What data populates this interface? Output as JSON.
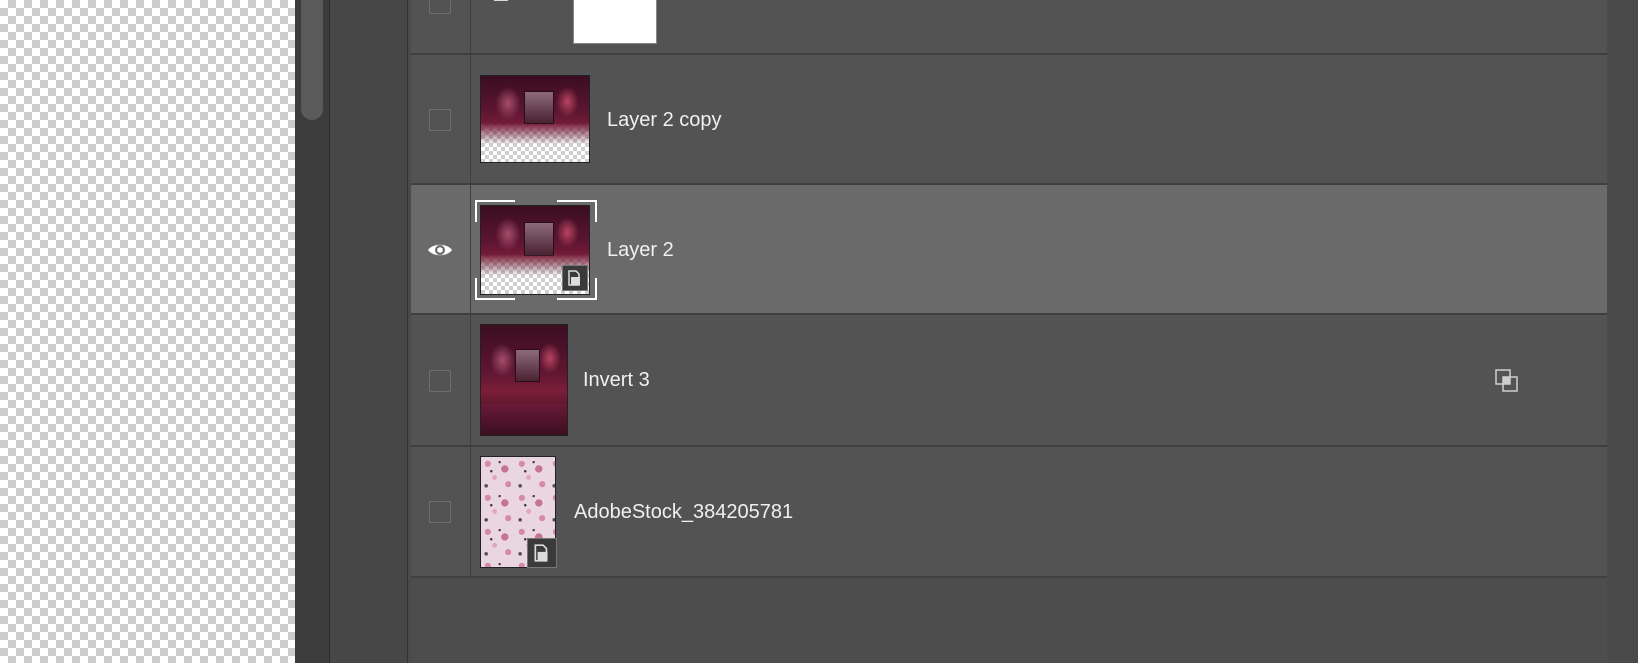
{
  "layers": [
    {
      "name": "",
      "visible": false,
      "thumbnail": "white-fill",
      "selected": false
    },
    {
      "name": "Layer 2 copy",
      "visible": false,
      "thumbnail": "car-photo-fade",
      "selected": false
    },
    {
      "name": "Layer 2",
      "visible": true,
      "thumbnail": "car-photo-fade",
      "smart_object": true,
      "selected": true
    },
    {
      "name": "Invert 3",
      "visible": false,
      "thumbnail": "car-photo",
      "linked": true,
      "selected": false
    },
    {
      "name": "AdobeStock_384205781",
      "visible": false,
      "thumbnail": "floral-pattern",
      "smart_object": true,
      "selected": false
    }
  ],
  "icons": {
    "visibility": "eye-icon",
    "smart_object": "smart-object-badge-icon",
    "link": "link-layers-icon"
  }
}
